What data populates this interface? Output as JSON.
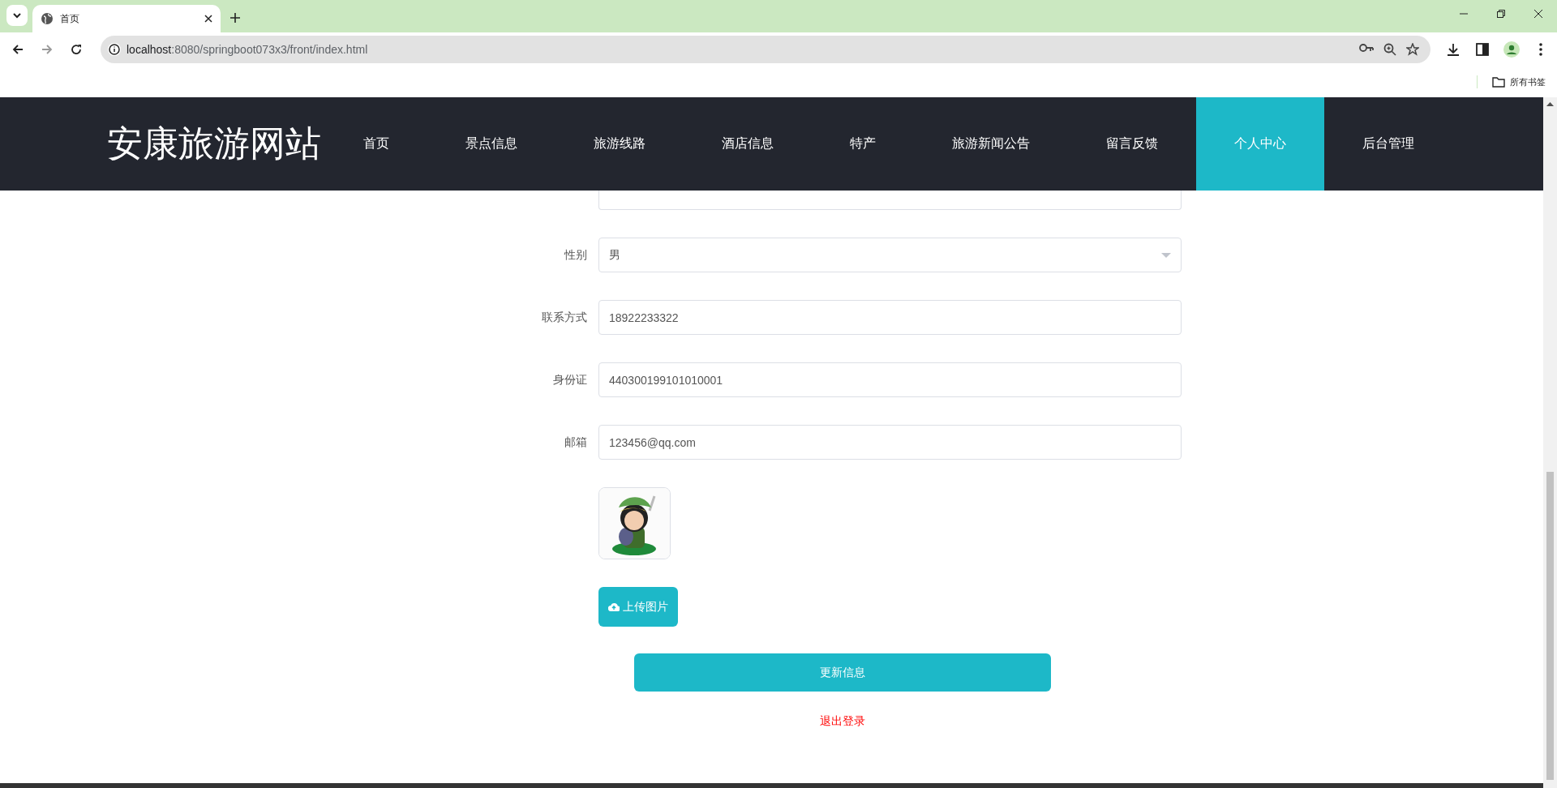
{
  "browser": {
    "tab_title": "首页",
    "url_host": "localhost",
    "url_path": ":8080/springboot073x3/front/index.html",
    "bookmarks_label": "所有书签"
  },
  "nav": {
    "logo": "安康旅游网站",
    "items": [
      {
        "label": "首页",
        "selected": false
      },
      {
        "label": "景点信息",
        "selected": false
      },
      {
        "label": "旅游线路",
        "selected": false
      },
      {
        "label": "酒店信息",
        "selected": false
      },
      {
        "label": "特产",
        "selected": false
      },
      {
        "label": "旅游新闻公告",
        "selected": false
      },
      {
        "label": "留言反馈",
        "selected": false
      },
      {
        "label": "个人中心",
        "selected": true
      },
      {
        "label": "后台管理",
        "selected": false
      }
    ]
  },
  "form": {
    "fields": [
      {
        "kind": "partial"
      },
      {
        "kind": "select",
        "label": "性别",
        "value": "男"
      },
      {
        "kind": "input",
        "label": "联系方式",
        "value": "18922233322"
      },
      {
        "kind": "input",
        "label": "身份证",
        "value": "440300199101010001"
      },
      {
        "kind": "input",
        "label": "邮箱",
        "value": "123456@qq.com"
      }
    ],
    "upload_button": "上传图片",
    "submit_button": "更新信息",
    "logout_link": "退出登录"
  }
}
